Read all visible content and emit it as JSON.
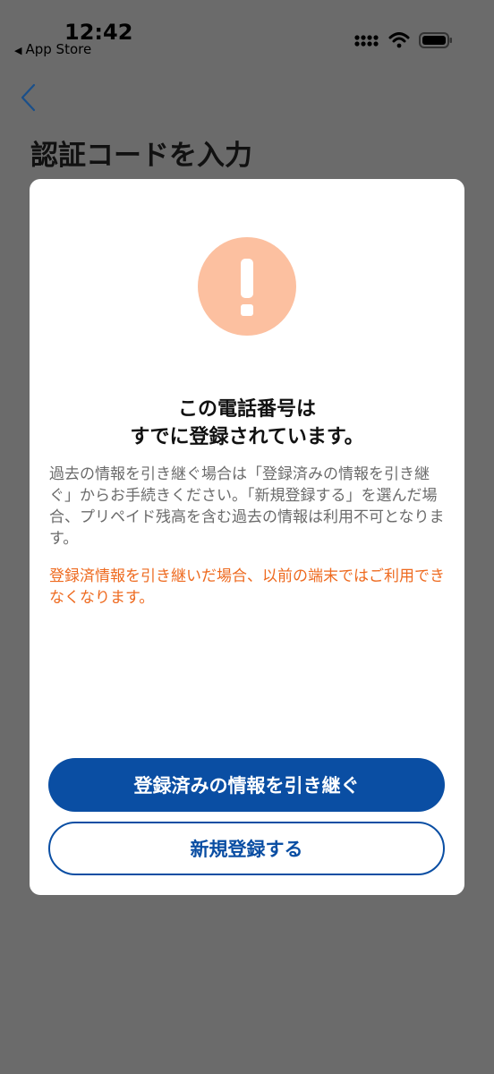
{
  "status_bar": {
    "time": "12:42",
    "back_app": "App Store",
    "icons": [
      "signal-icon",
      "wifi-icon",
      "battery-icon"
    ]
  },
  "nav": {
    "back_icon": "chevron-left-icon"
  },
  "page": {
    "title": "認証コードを入力"
  },
  "modal": {
    "icon": "exclamation-icon",
    "icon_color": "#fcc0a0",
    "title_line1": "この電話番号は",
    "title_line2": "すでに登録されています。",
    "body": "過去の情報を引き継ぐ場合は「登録済みの情報を引き継ぐ」からお手続きください。「新規登録する」を選んだ場合、プリペイド残高を含む過去の情報は利用不可となります。",
    "warning": "登録済情報を引き継いだ場合、以前の端末ではご利用できなくなります。",
    "warning_color": "#ee6a1f",
    "primary_button": "登録済みの情報を引き継ぐ",
    "secondary_button": "新規登録する",
    "accent_color": "#0a4ea3"
  }
}
